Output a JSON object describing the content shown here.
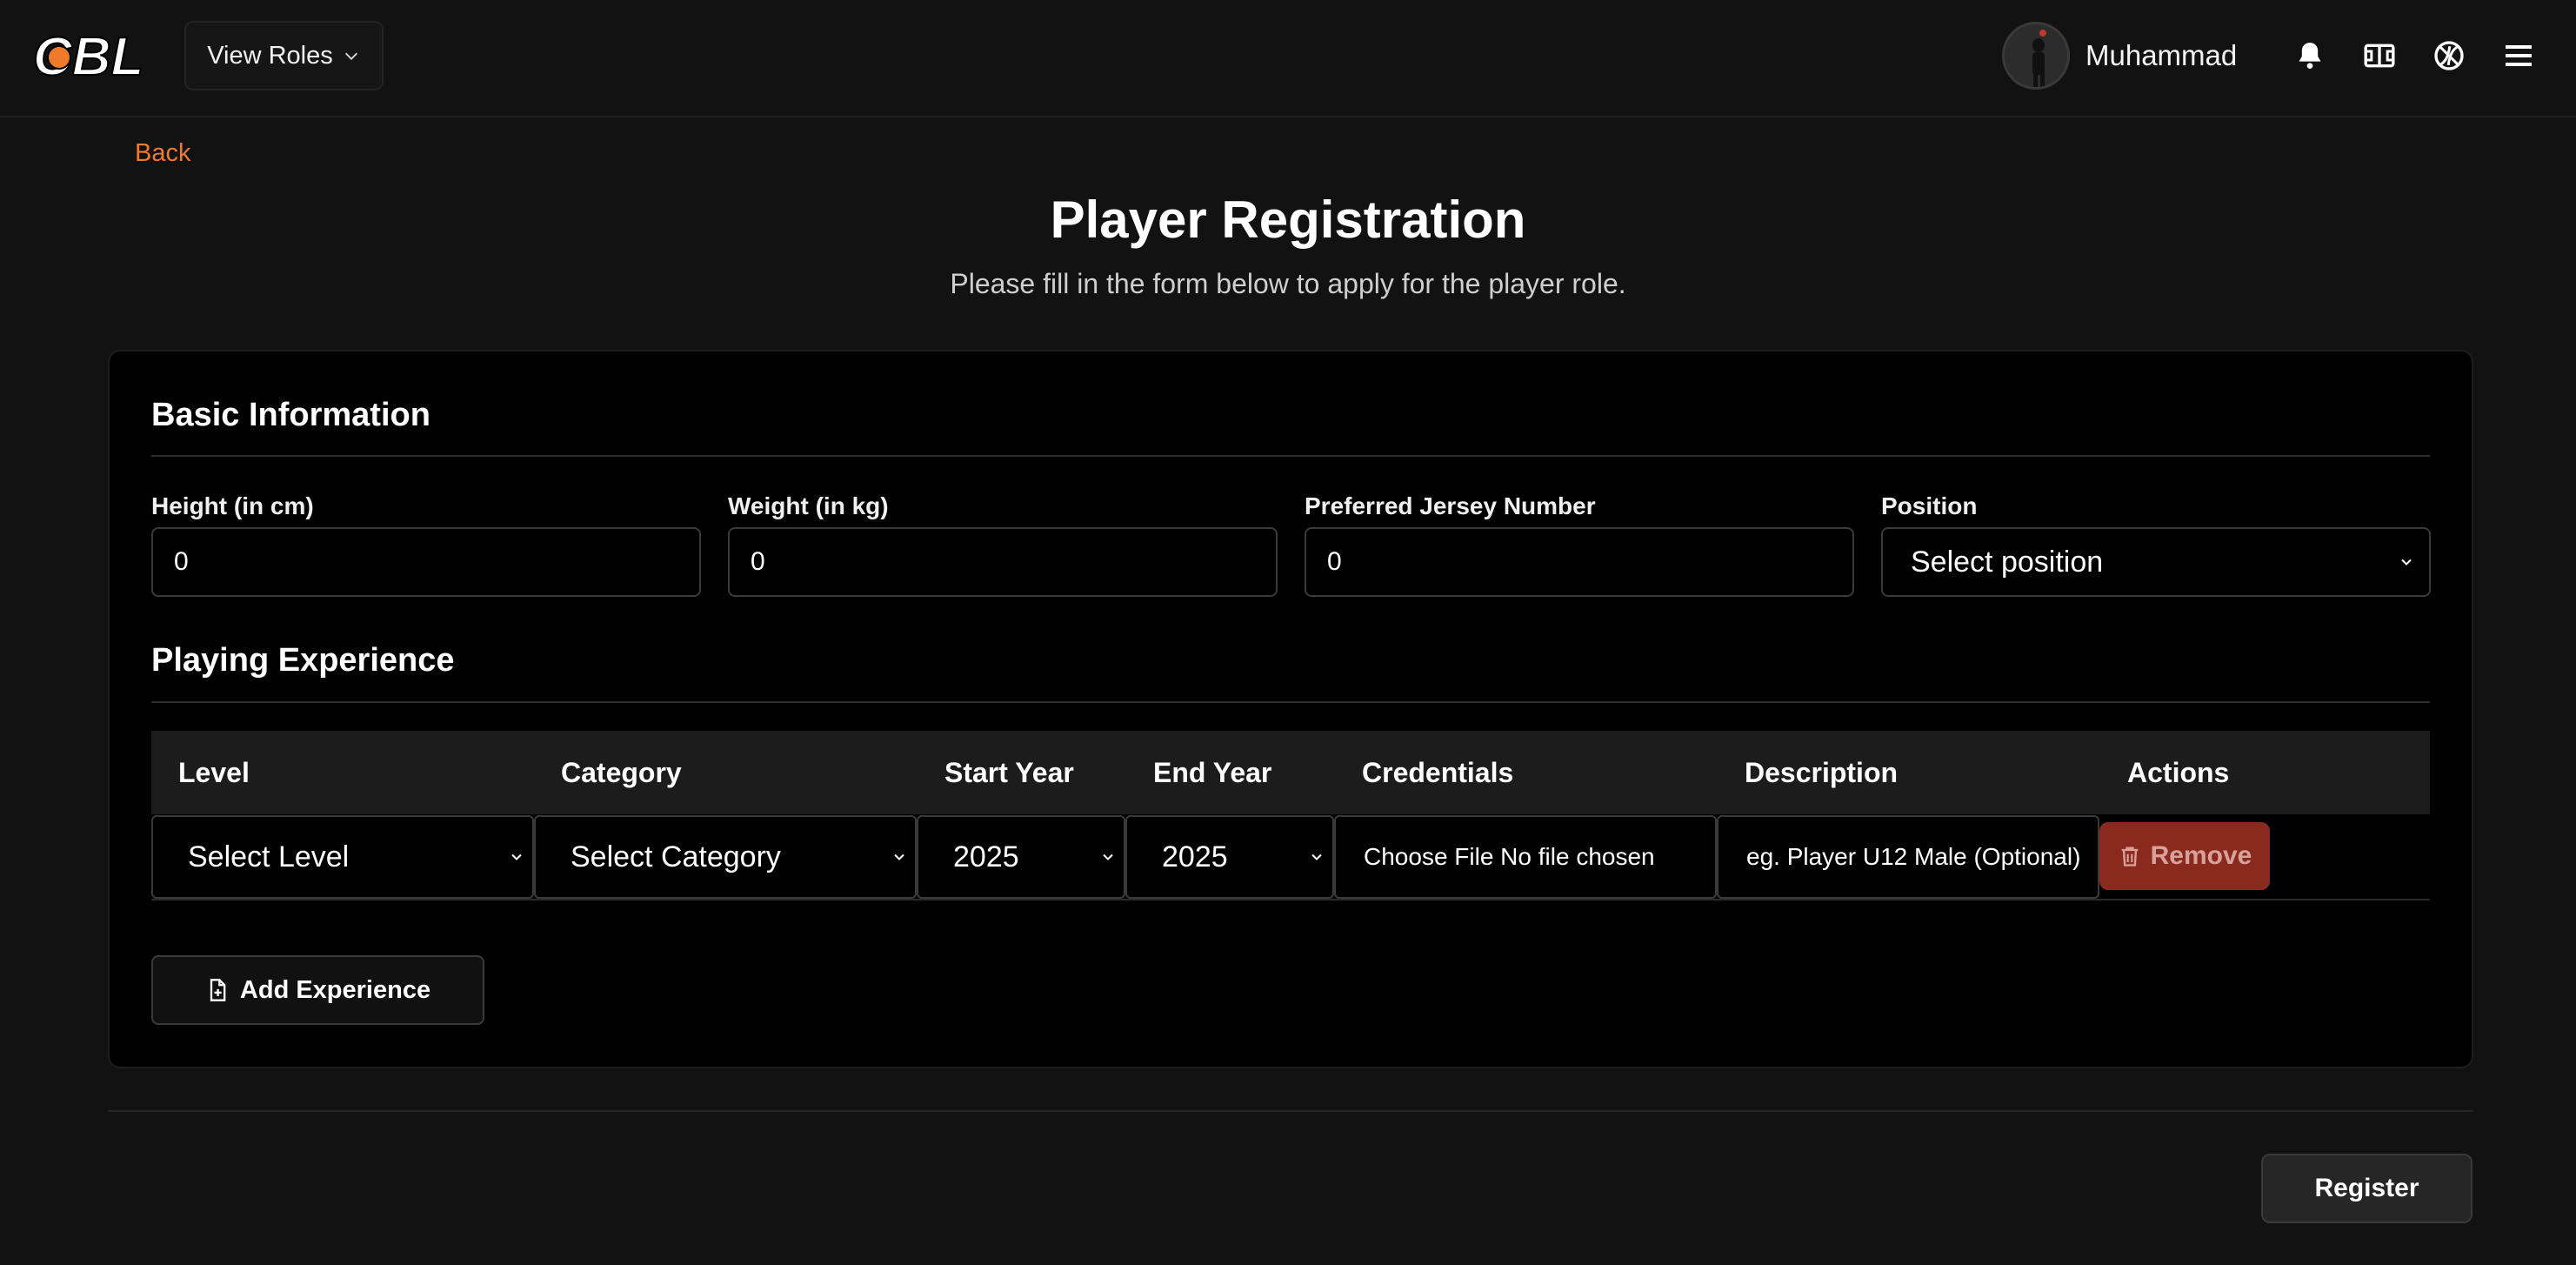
{
  "header": {
    "logo_text": "CBL",
    "view_roles_label": "View Roles",
    "user_name": "Muhammad"
  },
  "page": {
    "back_label": "Back",
    "title": "Player Registration",
    "subtitle": "Please fill in the form below to apply for the player role."
  },
  "basic_info": {
    "title": "Basic Information",
    "fields": [
      {
        "label": "Height (in cm)",
        "value": "0"
      },
      {
        "label": "Weight (in kg)",
        "value": "0"
      },
      {
        "label": "Preferred Jersey Number",
        "value": "0"
      },
      {
        "label": "Position",
        "value": "Select position"
      }
    ]
  },
  "experience": {
    "title": "Playing Experience",
    "columns": [
      "Level",
      "Category",
      "Start Year",
      "End Year",
      "Credentials",
      "Description",
      "Actions"
    ],
    "row": {
      "level": "Select Level",
      "category": "Select Category",
      "start_year": "2025",
      "end_year": "2025",
      "credentials": "Choose File No file chosen",
      "description_placeholder": "eg. Player U12 Male (Optional)",
      "remove_label": "Remove"
    },
    "add_label": "Add Experience"
  },
  "register_label": "Register",
  "colors": {
    "accent": "#f07a2a",
    "remove_bg": "#8a2a1f",
    "background": "#121212"
  }
}
